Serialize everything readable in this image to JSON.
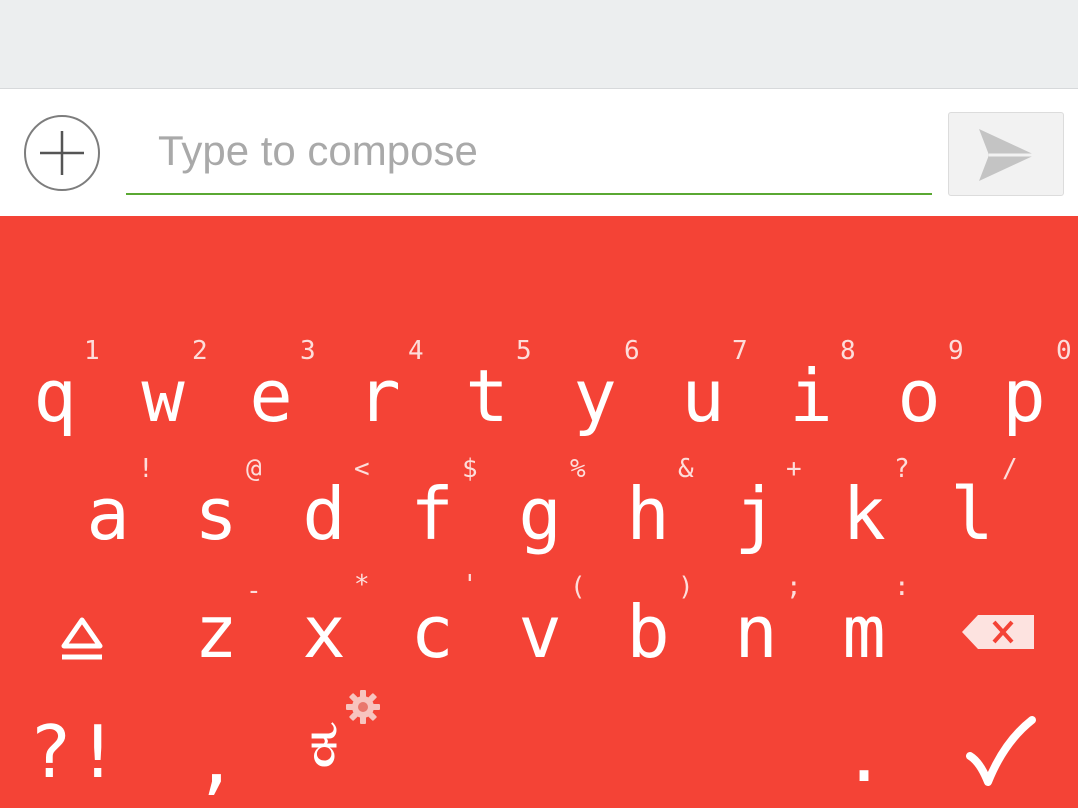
{
  "compose": {
    "placeholder": "Type to compose",
    "attach_icon": "plus-circle-icon",
    "send_icon": "send-icon"
  },
  "keyboard": {
    "row1": [
      {
        "key": "q",
        "hint": "1"
      },
      {
        "key": "w",
        "hint": "2"
      },
      {
        "key": "e",
        "hint": "3"
      },
      {
        "key": "r",
        "hint": "4"
      },
      {
        "key": "t",
        "hint": "5"
      },
      {
        "key": "y",
        "hint": "6"
      },
      {
        "key": "u",
        "hint": "7"
      },
      {
        "key": "i",
        "hint": "8"
      },
      {
        "key": "o",
        "hint": "9"
      },
      {
        "key": "p",
        "hint": "0"
      }
    ],
    "row2": [
      {
        "key": "a",
        "hint": "!"
      },
      {
        "key": "s",
        "hint": "@"
      },
      {
        "key": "d",
        "hint": "<"
      },
      {
        "key": "f",
        "hint": "$"
      },
      {
        "key": "g",
        "hint": "%"
      },
      {
        "key": "h",
        "hint": "&"
      },
      {
        "key": "j",
        "hint": "+"
      },
      {
        "key": "k",
        "hint": "?"
      },
      {
        "key": "l",
        "hint": "/"
      }
    ],
    "row3": [
      {
        "key": "z",
        "hint": "-"
      },
      {
        "key": "x",
        "hint": "*"
      },
      {
        "key": "c",
        "hint": "'"
      },
      {
        "key": "v",
        "hint": "("
      },
      {
        "key": "b",
        "hint": ")"
      },
      {
        "key": "n",
        "hint": ";"
      },
      {
        "key": "m",
        "hint": ":"
      }
    ],
    "shift_icon": "shift-icon",
    "backspace_icon": "backspace-icon",
    "symbols_label": "?!",
    "comma_label": ",",
    "language_label": "ಕ",
    "language_settings_icon": "gear-icon",
    "period_label": ".",
    "enter_icon": "checkmark-icon",
    "colors": {
      "keyboard_bg": "#f44336",
      "key_text": "#ffffff",
      "input_underline": "#5aa832"
    }
  }
}
